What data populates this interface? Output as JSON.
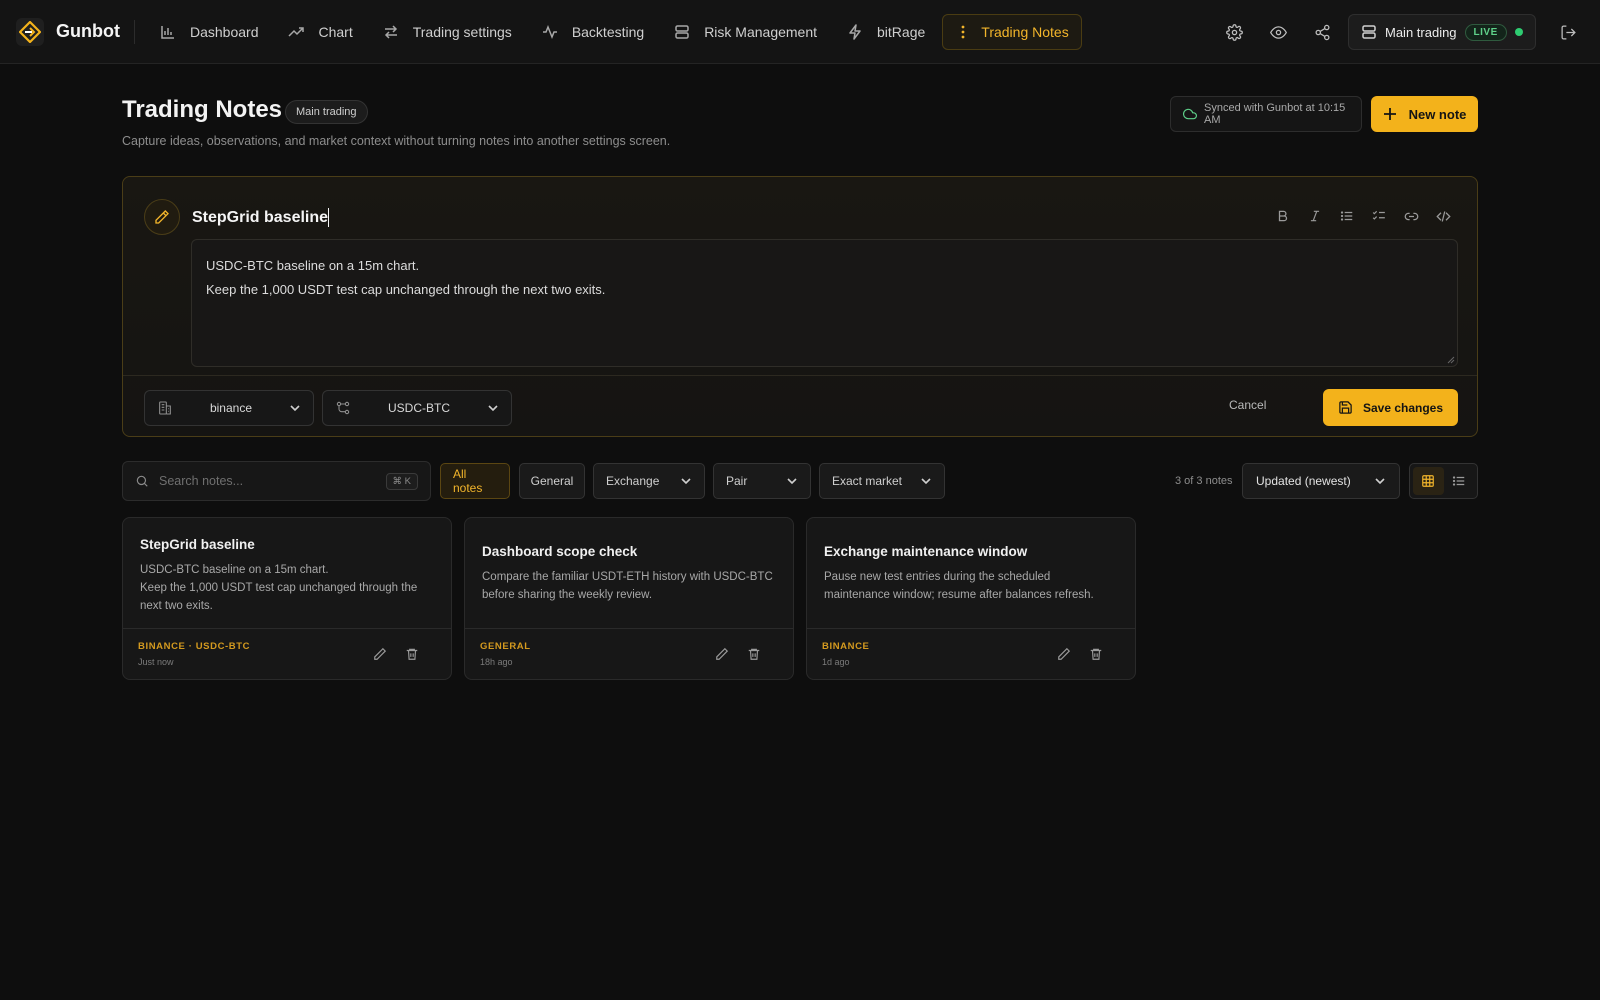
{
  "app": {
    "brand": "Gunbot",
    "nav": [
      {
        "label": "Dashboard",
        "icon": "bar-chart-icon"
      },
      {
        "label": "Chart",
        "icon": "trend-up-icon"
      },
      {
        "label": "Trading settings",
        "icon": "arrows-swap-icon"
      },
      {
        "label": "Backtesting",
        "icon": "pulse-icon"
      },
      {
        "label": "Risk Management",
        "icon": "server-icon"
      },
      {
        "label": "bitRage",
        "icon": "bolt-icon"
      },
      {
        "label": "Trading Notes",
        "icon": "more-vertical-icon",
        "active": true
      }
    ],
    "account": {
      "name": "Main trading",
      "status": "LIVE",
      "status_color": "#2ecc71"
    }
  },
  "page": {
    "title": "Trading Notes",
    "scope": "Main trading",
    "subtitle": "Capture ideas, observations, and market context without turning notes into another settings screen.",
    "sync_status": "Synced with Gunbot at 10:15 AM",
    "new_note_label": "New note"
  },
  "editor": {
    "title": "StepGrid baseline",
    "body_line1": "USDC-BTC baseline on a 15m chart.",
    "body_line2": "Keep the 1,000 USDT test cap unchanged through the next two exits.",
    "exchange": "binance",
    "pair": "USDC-BTC",
    "cancel_label": "Cancel",
    "save_label": "Save changes"
  },
  "filters": {
    "search_placeholder": "Search notes...",
    "search_shortcut": "⌘ K",
    "chips": {
      "all": "All notes",
      "general": "General",
      "exchange": "Exchange",
      "pair": "Pair",
      "market": "Exact market"
    },
    "count": "3 of 3 notes",
    "sort": "Updated (newest)"
  },
  "notes": [
    {
      "title": "StepGrid baseline",
      "text": "USDC-BTC baseline on a 15m chart.\nKeep the 1,000 USDT test cap unchanged through the next two exits.",
      "tag": "BINANCE · USDC-BTC",
      "time": "Just now"
    },
    {
      "title": "Dashboard scope check",
      "text": "Compare the familiar USDT-ETH history with USDC-BTC before sharing the weekly review.",
      "tag": "GENERAL",
      "time": "18h ago"
    },
    {
      "title": "Exchange maintenance window",
      "text": "Pause new test entries during the scheduled maintenance window; resume after balances refresh.",
      "tag": "BINANCE",
      "time": "1d ago"
    }
  ],
  "colors": {
    "accent": "#f3b21b",
    "background": "#0e0e0e",
    "live": "#2ecc71"
  }
}
